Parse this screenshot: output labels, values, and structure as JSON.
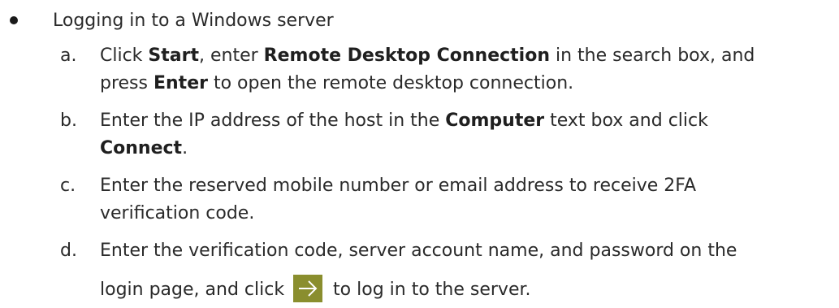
{
  "bullet": {
    "text": "Logging in to a Windows server"
  },
  "steps": [
    {
      "marker": "a.",
      "line1": [
        "Click ",
        "Start",
        ", enter ",
        "Remote Desktop Connection",
        " in the search box, and"
      ],
      "line2": [
        "press ",
        "Enter",
        " to open the remote desktop connection."
      ]
    },
    {
      "marker": "b.",
      "line1": [
        "Enter the IP address of the host in the ",
        "Computer",
        " text box and click"
      ],
      "line2": [
        "Connect",
        "."
      ]
    },
    {
      "marker": "c.",
      "line1": [
        "Enter the reserved mobile number or email address to receive 2FA"
      ],
      "line2": [
        "verification code."
      ]
    },
    {
      "marker": "d.",
      "line1": [
        "Enter the verification code, server account name, and password on the"
      ],
      "line2_before": "login page, and click ",
      "line2_after": " to log in to the server."
    }
  ],
  "colors": {
    "text": "#2a2a2a",
    "arrow_button_bg": "#8a8e2e",
    "arrow_icon": "#ffffff"
  },
  "icons": {
    "login_arrow": "right-arrow-icon"
  }
}
